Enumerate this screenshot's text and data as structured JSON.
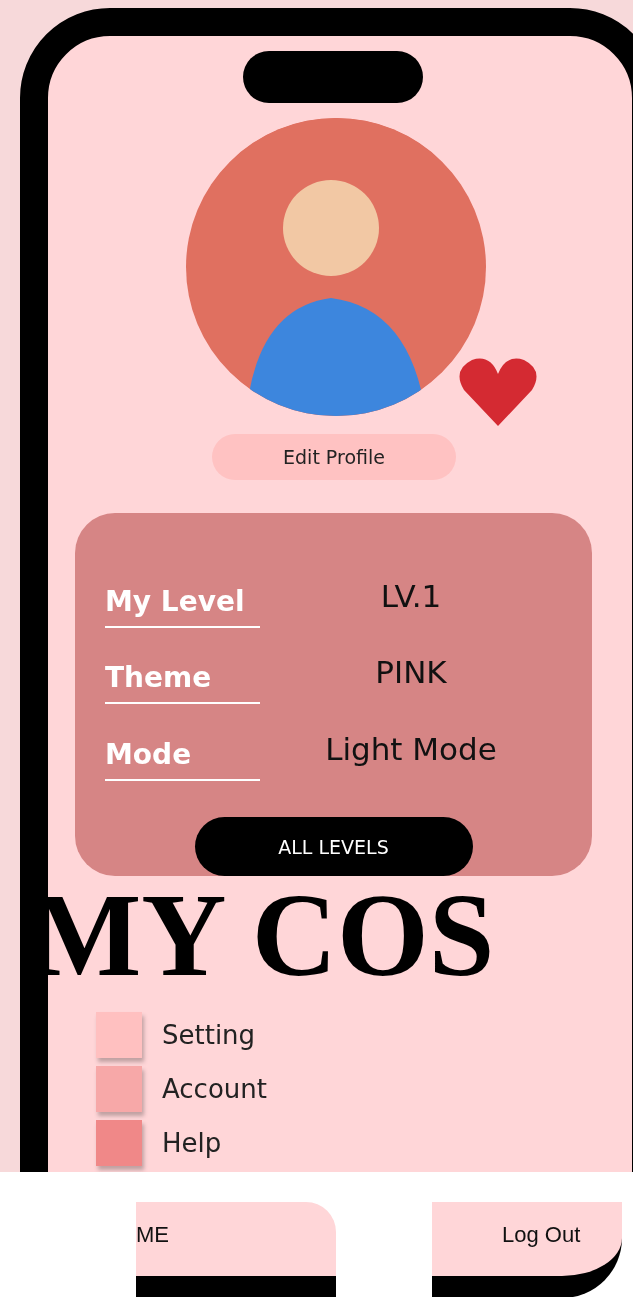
{
  "profile": {
    "edit_button": "Edit Profile"
  },
  "info_card": {
    "rows": [
      {
        "label": "My Level",
        "value": "LV.1"
      },
      {
        "label": "Theme",
        "value": "PINK"
      },
      {
        "label": "Mode",
        "value": "Light Mode"
      }
    ],
    "button": "ALL LEVELS"
  },
  "menu": [
    {
      "label": "Setting",
      "color": "#ffc0c0"
    },
    {
      "label": "Account",
      "color": "#f7a8a8"
    },
    {
      "label": "Help",
      "color": "#f08888"
    }
  ],
  "bottom_nav": [
    "ME",
    "Log Out"
  ],
  "overlay_title": "MY COS"
}
